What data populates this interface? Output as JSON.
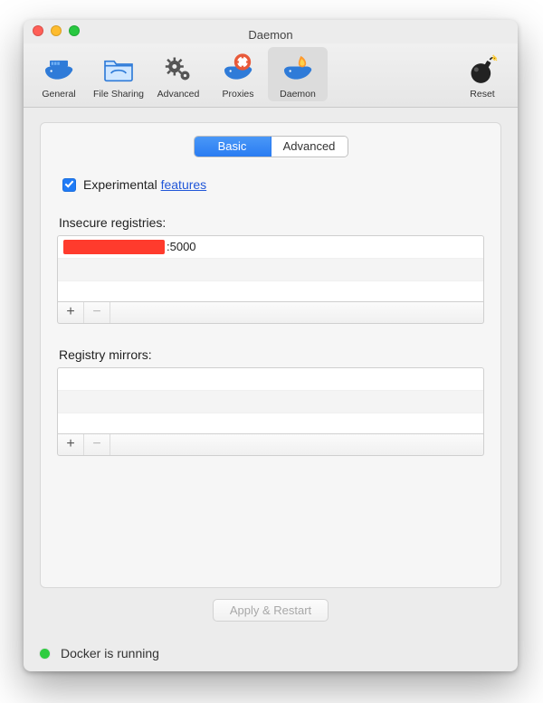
{
  "window": {
    "title": "Daemon"
  },
  "toolbar": {
    "items": [
      {
        "id": "general",
        "label": "General"
      },
      {
        "id": "filesharing",
        "label": "File Sharing"
      },
      {
        "id": "advanced",
        "label": "Advanced"
      },
      {
        "id": "proxies",
        "label": "Proxies"
      },
      {
        "id": "daemon",
        "label": "Daemon",
        "selected": true
      }
    ],
    "reset": {
      "label": "Reset"
    }
  },
  "tabs": {
    "basic": "Basic",
    "advanced": "Advanced",
    "active": "basic"
  },
  "experimental": {
    "checkbox_label_prefix": "Experimental ",
    "link_text": "features",
    "checked": true
  },
  "insecure": {
    "label": "Insecure registries:",
    "rows": [
      {
        "redacted": true,
        "suffix": ":5000"
      }
    ]
  },
  "mirrors": {
    "label": "Registry mirrors:",
    "rows": []
  },
  "buttons": {
    "add": "+",
    "remove": "−",
    "apply": "Apply & Restart"
  },
  "status": {
    "text": "Docker is running",
    "color": "#2ecc40"
  }
}
